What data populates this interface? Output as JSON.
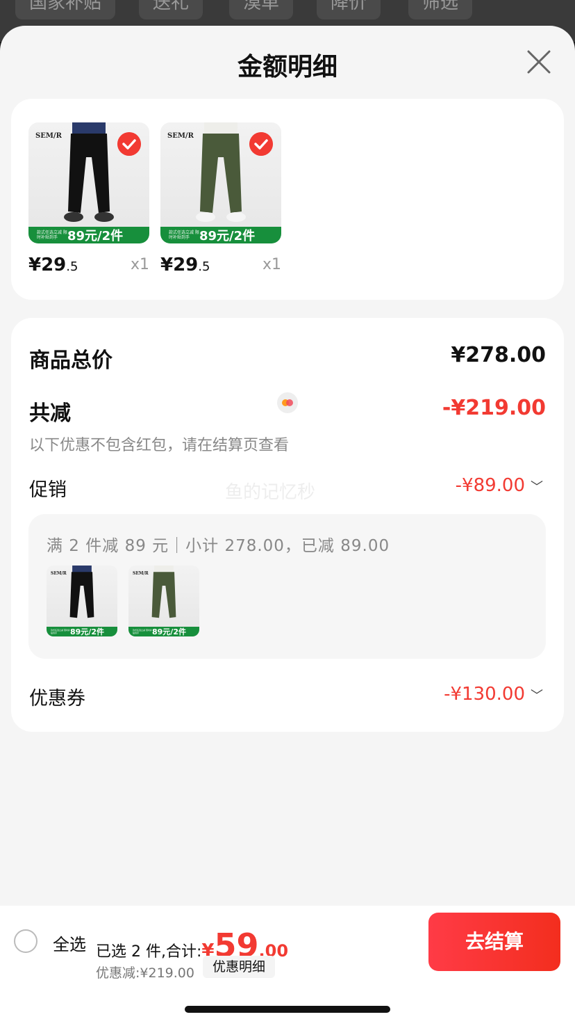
{
  "background": {
    "filters": [
      "国家补贴",
      "送礼",
      "漠单",
      "降价",
      "筛选"
    ]
  },
  "sheet": {
    "title": "金额明细"
  },
  "items": [
    {
      "brand": "SEM/R",
      "banner_sub": "款式任选立减 限时补贴到手",
      "banner_main": "89元/2件",
      "price_int": "¥29",
      "price_dec": ".5",
      "qty": "x1",
      "pants_color": "#111111",
      "checked": true
    },
    {
      "brand": "SEM/R",
      "banner_sub": "款式任选立减 限时补贴到手",
      "banner_main": "89元/2件",
      "price_int": "¥29",
      "price_dec": ".5",
      "qty": "x1",
      "pants_color": "#4a5a3a",
      "checked": true
    }
  ],
  "summary": {
    "total_label": "商品总价",
    "total_value": "¥278.00",
    "reduce_label": "共减",
    "reduce_value": "-¥219.00",
    "reduce_hint": "以下优惠不包含红包，请在结算页查看",
    "promo_label": "促销",
    "promo_value": "-¥89.00",
    "promo_detail": "满 2 件减 89 元｜小计 278.00，已减 89.00",
    "coupon_label": "优惠券",
    "coupon_value": "-¥130.00",
    "watermark": "鱼的记忆秒"
  },
  "bottom": {
    "select_all": "全选",
    "selected_prefix": "已选 2 件,合计:",
    "total_symbol": "¥",
    "total_int": "59",
    "total_dec": ".00",
    "saved": "优惠减:¥219.00",
    "detail_button": "优惠明细",
    "checkout_button": "去结算"
  },
  "colors": {
    "accent_red": "#f23a32",
    "banner_green": "#178f3c"
  }
}
